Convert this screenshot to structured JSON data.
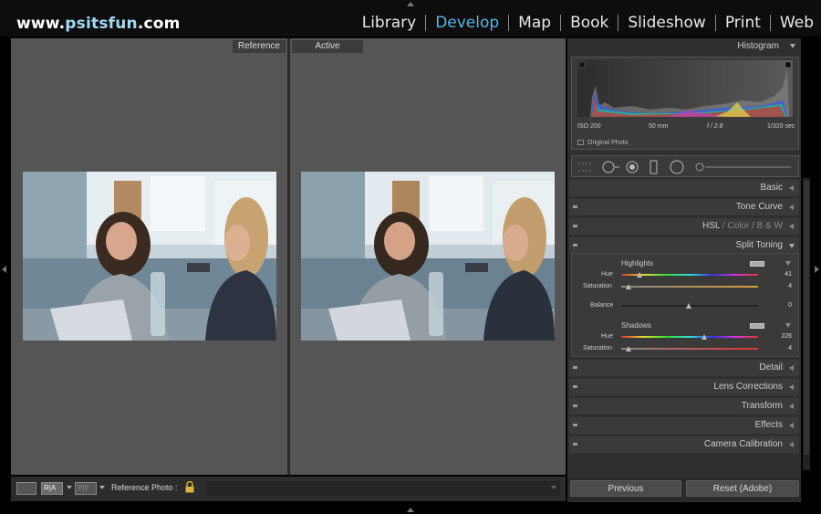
{
  "brand": {
    "prefix": "www.",
    "accent": "psitsfun",
    "suffix": ".com"
  },
  "modules": [
    {
      "label": "Library",
      "active": false
    },
    {
      "label": "Develop",
      "active": true
    },
    {
      "label": "Map",
      "active": false
    },
    {
      "label": "Book",
      "active": false
    },
    {
      "label": "Slideshow",
      "active": false
    },
    {
      "label": "Print",
      "active": false
    },
    {
      "label": "Web",
      "active": false
    }
  ],
  "compare": {
    "reference_label": "Reference",
    "active_label": "Active"
  },
  "toolbar": {
    "view_a": "R|A",
    "view_b": "Y|Y",
    "reference_photo_label": "Reference Photo :"
  },
  "histogram": {
    "title": "Histogram",
    "iso": "ISO 200",
    "focal": "50 mm",
    "aperture": "f / 2.8",
    "shutter": "1/320 sec",
    "original_photo": "Original Photo"
  },
  "panels": {
    "basic": "Basic",
    "tone_curve": "Tone Curve",
    "hsl": "HSL",
    "color": "Color",
    "bw": "B & W",
    "split_toning": "Split Toning",
    "detail": "Detail",
    "lens_corrections": "Lens Corrections",
    "transform": "Transform",
    "effects": "Effects",
    "camera_calibration": "Camera Calibration"
  },
  "split_toning": {
    "highlights": {
      "title": "Highlights",
      "hue_label": "Hue",
      "hue": "41",
      "saturation_label": "Saturation",
      "saturation": "4"
    },
    "balance": {
      "label": "Balance",
      "value": "0"
    },
    "shadows": {
      "title": "Shadows",
      "hue_label": "Hue",
      "hue": "226",
      "saturation_label": "Saturation",
      "saturation": "4"
    }
  },
  "buttons": {
    "previous": "Previous",
    "reset": "Reset (Adobe)"
  },
  "colors": {
    "accent": "#55b7e6",
    "panel": "#2f2f2f",
    "center_bg": "#555555"
  }
}
